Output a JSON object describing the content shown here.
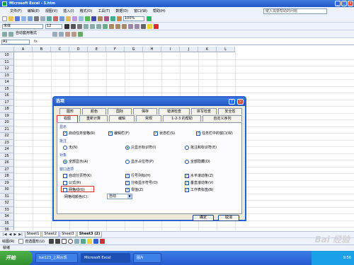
{
  "window": {
    "title": "Microsoft Excel - 3.htm",
    "min": "_",
    "max": "□",
    "close": "×"
  },
  "menu": [
    "文件(F)",
    "编辑(E)",
    "视图(V)",
    "插入(I)",
    "格式(O)",
    "工具(T)",
    "数据(D)",
    "窗口(W)",
    "帮助(H)"
  ],
  "help_placeholder": "键入需要帮助的问题",
  "toolbar": {
    "font": "宋体",
    "size": "12",
    "zoom": "100%",
    "autoformat": "自动套用格式"
  },
  "namebox": "A1",
  "fx": "fx",
  "columns": [
    "A",
    "B",
    "C",
    "D",
    "E",
    "F",
    "G",
    "H",
    "I",
    "J",
    "K",
    "L"
  ],
  "rows": [
    "10",
    "11",
    "12",
    "13",
    "14",
    "15",
    "16",
    "17",
    "18",
    "19",
    "20",
    "21",
    "22",
    "23",
    "24",
    "25",
    "26",
    "27",
    "28",
    "29",
    "30",
    "31",
    "32",
    "33",
    "34",
    "35",
    "36"
  ],
  "sheet_tabs": [
    "Sheet1",
    "Sheet2",
    "Sheet3",
    "Sheet3 (2)"
  ],
  "active_tab": "Sheet3 (2)",
  "draw_label": "绘图(R)",
  "autoshapes_label": "自选图形(U)",
  "status": "就绪",
  "taskbar": {
    "start": "开始",
    "tasks": [
      "bai123_上网从现",
      "Microsoft Excel",
      "图片"
    ],
    "time": "9:56"
  },
  "dialog": {
    "title": "选项",
    "help": "?",
    "close": "×",
    "tabs_row1": [
      "图形",
      "颜色",
      "国际",
      "保存",
      "错误检查",
      "拼写检查",
      "安全性"
    ],
    "tabs_row2": [
      "视图",
      "重新计算",
      "编辑",
      "常规",
      "1-2-3 的帮助",
      "自定义序列"
    ],
    "groups": {
      "show": "显示",
      "comments": "批注",
      "objects": "对象",
      "window": "窗口选项"
    },
    "show_opts": [
      "启动任务窗格(R)",
      "编辑栏(F)",
      "状态栏(S)",
      "任务栏中的窗口(W)"
    ],
    "comment_opts": [
      "无(N)",
      "只显示标识符(I)",
      "批注和标识符(E)"
    ],
    "object_opts": [
      "全部显示(A)",
      "显示占位符(P)",
      "全部隐藏(D)"
    ],
    "window_opts": [
      [
        "自动分页符(K)",
        "行号列标(H)",
        "水平滚动条(Z)"
      ],
      [
        "公式(R)",
        "分级显示符号(O)",
        "垂直滚动条(V)"
      ],
      [
        "网格线(G)",
        "零值(Z)",
        "工作表标签(B)"
      ]
    ],
    "gridline_color_label": "网格线颜色(C):",
    "gridline_color_value": "自动",
    "ok": "确定",
    "cancel": "取消"
  },
  "watermark": "Bai 经验"
}
